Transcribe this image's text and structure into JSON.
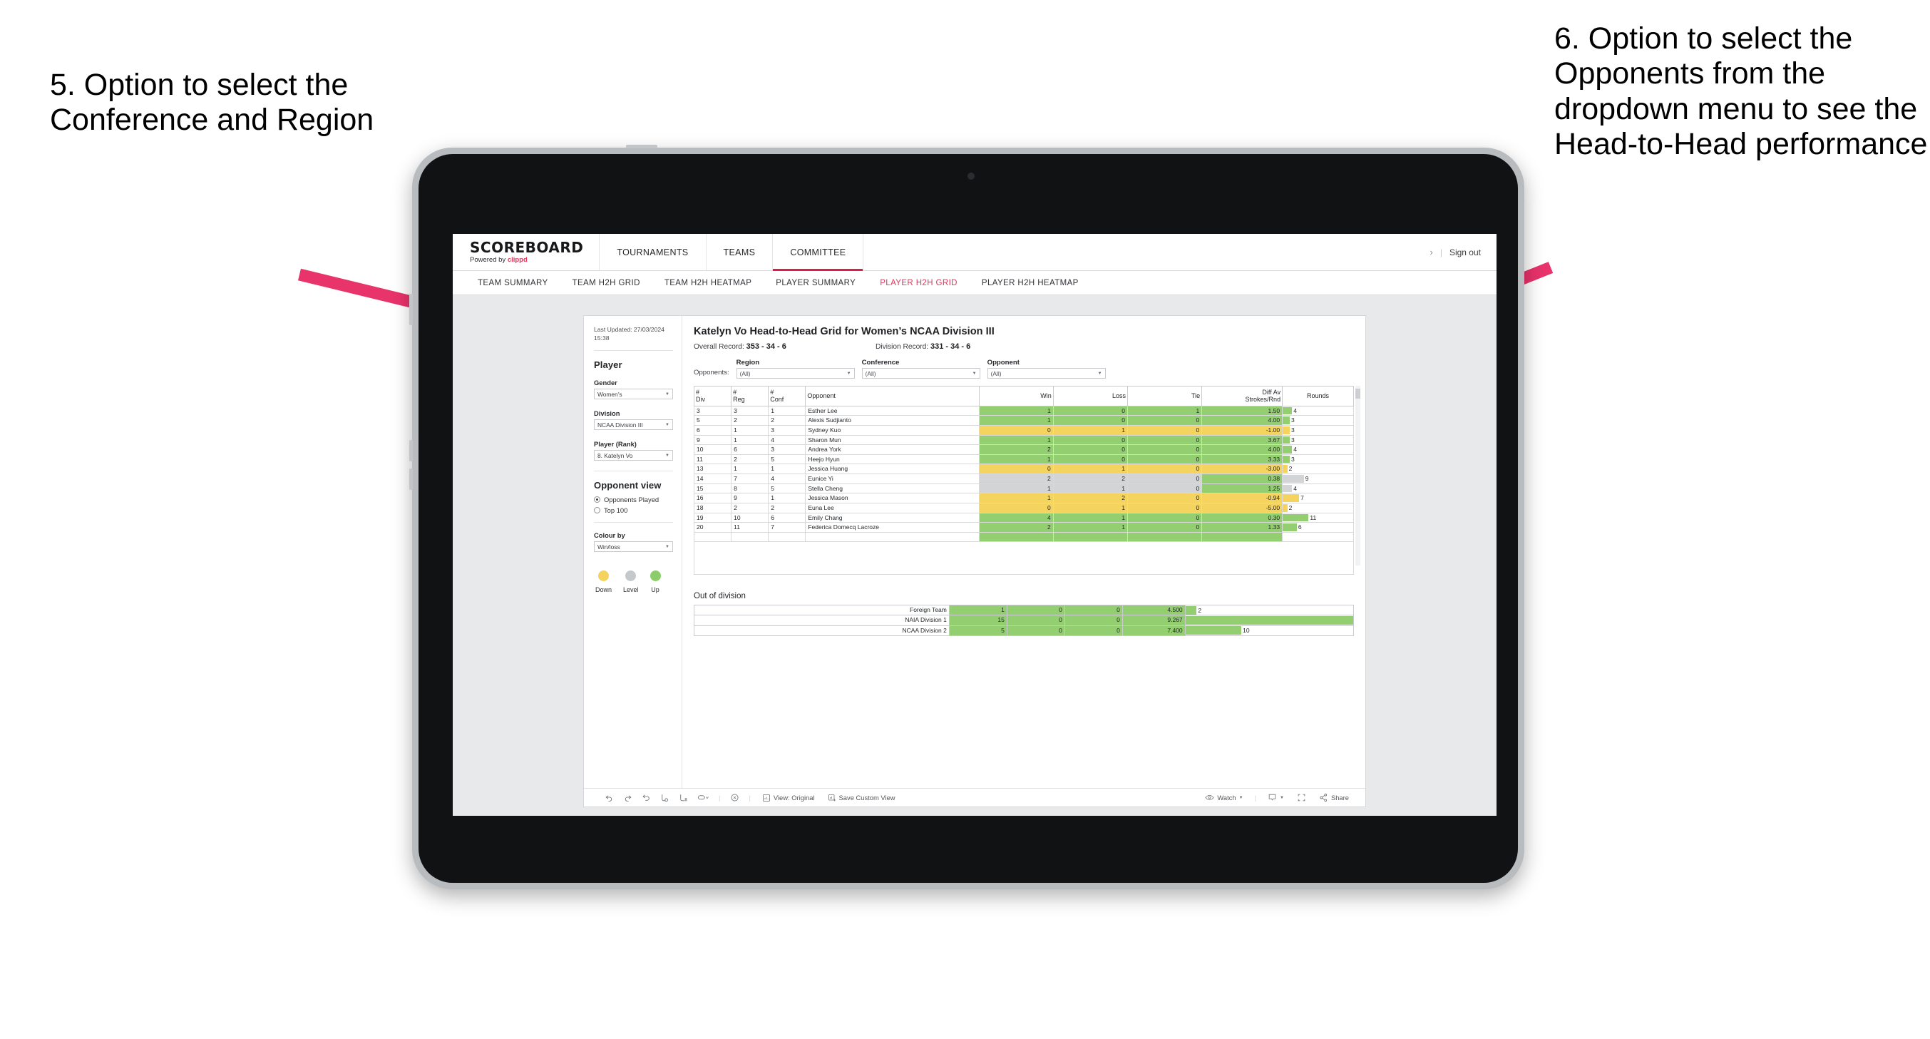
{
  "annotations": {
    "left": "5. Option to select the Conference and Region",
    "right": "6. Option to select the Opponents from the dropdown menu to see the Head-to-Head performance"
  },
  "colors": {
    "accent": "#e8335a",
    "active_tab": "#d81f4a",
    "up_green": "#93ce70",
    "down_yellow": "#f4d35e",
    "level_grey": "#d2d4d6",
    "arrow": "#e8336b"
  },
  "header": {
    "brand_title": "SCOREBOARD",
    "brand_sub_prefix": "Powered by ",
    "brand_sub_name": "clippd",
    "nav": [
      {
        "label": "TOURNAMENTS",
        "active": false
      },
      {
        "label": "TEAMS",
        "active": false
      },
      {
        "label": "COMMITTEE",
        "active": true
      }
    ],
    "chevron": "›",
    "separator": "|",
    "sign_out": "Sign out"
  },
  "subnav": [
    {
      "label": "TEAM SUMMARY",
      "active": false
    },
    {
      "label": "TEAM H2H GRID",
      "active": false
    },
    {
      "label": "TEAM H2H HEATMAP",
      "active": false
    },
    {
      "label": "PLAYER SUMMARY",
      "active": false
    },
    {
      "label": "PLAYER H2H GRID",
      "active": true
    },
    {
      "label": "PLAYER H2H HEATMAP",
      "active": false
    }
  ],
  "filter_panel": {
    "last_updated": "Last Updated: 27/03/2024",
    "last_updated_time": "15:38",
    "section_title": "Player",
    "fields": [
      {
        "label": "Gender",
        "value": "Women’s"
      },
      {
        "label": "Division",
        "value": "NCAA Division III"
      },
      {
        "label": "Player (Rank)",
        "value": "8. Katelyn Vo"
      }
    ],
    "opponent_view": {
      "title": "Opponent view",
      "options": [
        {
          "label": "Opponents Played",
          "selected": true
        },
        {
          "label": "Top 100",
          "selected": false
        }
      ]
    },
    "colour_by": {
      "label": "Colour by",
      "value": "Win/loss"
    },
    "legend": [
      {
        "label": "Down",
        "color": "#f4d35e"
      },
      {
        "label": "Level",
        "color": "#c6c9cc"
      },
      {
        "label": "Up",
        "color": "#8ccc6a"
      }
    ]
  },
  "viz": {
    "title": "Katelyn Vo Head-to-Head Grid for Women’s NCAA Division III",
    "overall_record_label": "Overall Record:",
    "overall_record_value": "353 - 34 - 6",
    "division_record_label": "Division Record:",
    "division_record_value": "331 -  34 - 6",
    "filters_label": "Opponents:",
    "filters": [
      {
        "label": "Region",
        "value": "(All)"
      },
      {
        "label": "Conference",
        "value": "(All)"
      },
      {
        "label": "Opponent",
        "value": "(All)"
      }
    ]
  },
  "chart_data": {
    "type": "table",
    "title": "Katelyn Vo Head-to-Head Grid for Women’s NCAA Division III",
    "columns": [
      "# Div",
      "# Reg",
      "# Conf",
      "Opponent",
      "Win",
      "Loss",
      "Tie",
      "Diff Av Strokes/Rnd",
      "Rounds"
    ],
    "column_headers_multiline": [
      {
        "l1": "#",
        "l2": "Div"
      },
      {
        "l1": "#",
        "l2": "Reg"
      },
      {
        "l1": "#",
        "l2": "Conf"
      },
      {
        "l1": "Opponent",
        "l2": ""
      },
      {
        "l1": "Win",
        "l2": ""
      },
      {
        "l1": "Loss",
        "l2": ""
      },
      {
        "l1": "Tie",
        "l2": ""
      },
      {
        "l1": "Diff Av",
        "l2": "Strokes/Rnd"
      },
      {
        "l1": "Rounds",
        "l2": ""
      }
    ],
    "rounds_max": 30,
    "rows": [
      {
        "div": "3",
        "reg": "3",
        "conf": "1",
        "opponent": "Esther Lee",
        "win": "1",
        "loss": "0",
        "tie": "1",
        "diff": "1.50",
        "rounds": "4",
        "state": "g"
      },
      {
        "div": "5",
        "reg": "2",
        "conf": "2",
        "opponent": "Alexis Sudjianto",
        "win": "1",
        "loss": "0",
        "tie": "0",
        "diff": "4.00",
        "rounds": "3",
        "state": "g"
      },
      {
        "div": "6",
        "reg": "1",
        "conf": "3",
        "opponent": "Sydney Kuo",
        "win": "0",
        "loss": "1",
        "tie": "0",
        "diff": "-1.00",
        "rounds": "3",
        "state": "y"
      },
      {
        "div": "9",
        "reg": "1",
        "conf": "4",
        "opponent": "Sharon Mun",
        "win": "1",
        "loss": "0",
        "tie": "0",
        "diff": "3.67",
        "rounds": "3",
        "state": "g"
      },
      {
        "div": "10",
        "reg": "6",
        "conf": "3",
        "opponent": "Andrea York",
        "win": "2",
        "loss": "0",
        "tie": "0",
        "diff": "4.00",
        "rounds": "4",
        "state": "g"
      },
      {
        "div": "11",
        "reg": "2",
        "conf": "5",
        "opponent": "Heejo Hyun",
        "win": "1",
        "loss": "0",
        "tie": "0",
        "diff": "3.33",
        "rounds": "3",
        "state": "g"
      },
      {
        "div": "13",
        "reg": "1",
        "conf": "1",
        "opponent": "Jessica Huang",
        "win": "0",
        "loss": "1",
        "tie": "0",
        "diff": "-3.00",
        "rounds": "2",
        "state": "y"
      },
      {
        "div": "14",
        "reg": "7",
        "conf": "4",
        "opponent": "Eunice Yi",
        "win": "2",
        "loss": "2",
        "tie": "0",
        "diff": "0.38",
        "rounds": "9",
        "state": "n",
        "diff_state": "g"
      },
      {
        "div": "15",
        "reg": "8",
        "conf": "5",
        "opponent": "Stella Cheng",
        "win": "1",
        "loss": "1",
        "tie": "0",
        "diff": "1.25",
        "rounds": "4",
        "state": "n",
        "diff_state": "g"
      },
      {
        "div": "16",
        "reg": "9",
        "conf": "1",
        "opponent": "Jessica Mason",
        "win": "1",
        "loss": "2",
        "tie": "0",
        "diff": "-0.94",
        "rounds": "7",
        "state": "y"
      },
      {
        "div": "18",
        "reg": "2",
        "conf": "2",
        "opponent": "Euna Lee",
        "win": "0",
        "loss": "1",
        "tie": "0",
        "diff": "-5.00",
        "rounds": "2",
        "state": "y"
      },
      {
        "div": "19",
        "reg": "10",
        "conf": "6",
        "opponent": "Emily Chang",
        "win": "4",
        "loss": "1",
        "tie": "0",
        "diff": "0.30",
        "rounds": "11",
        "state": "g"
      },
      {
        "div": "20",
        "reg": "11",
        "conf": "7",
        "opponent": "Federica Domecq Lacroze",
        "win": "2",
        "loss": "1",
        "tie": "0",
        "diff": "1.33",
        "rounds": "6",
        "state": "g"
      }
    ]
  },
  "out_of_division": {
    "title": "Out of division",
    "rounds_max": 30,
    "rows": [
      {
        "name": "Foreign Team",
        "win": "1",
        "loss": "0",
        "tie": "0",
        "diff": "4.500",
        "rounds": "2",
        "state": "g"
      },
      {
        "name": "NAIA Division 1",
        "win": "15",
        "loss": "0",
        "tie": "0",
        "diff": "9.267",
        "rounds": "30",
        "state": "g"
      },
      {
        "name": "NCAA Division 2",
        "win": "5",
        "loss": "0",
        "tie": "0",
        "diff": "7.400",
        "rounds": "10",
        "state": "g"
      }
    ]
  },
  "toolbar": {
    "view_label": "View: Original",
    "save_label": "Save Custom View",
    "watch_label": "Watch",
    "share_label": "Share",
    "separator": "|"
  }
}
